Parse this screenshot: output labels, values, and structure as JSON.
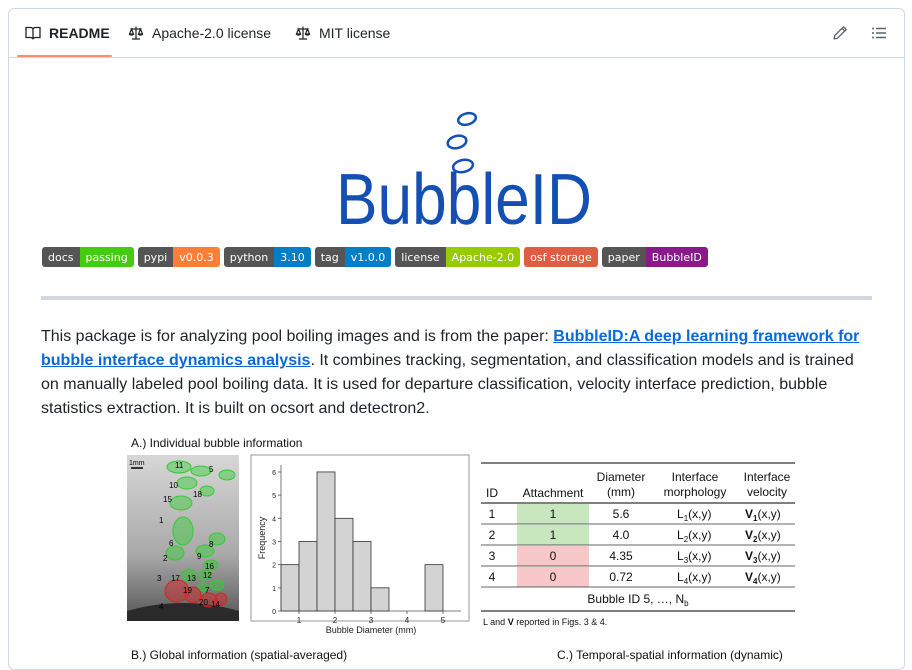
{
  "tabs": [
    {
      "label": "README",
      "icon": "book-icon",
      "active": true
    },
    {
      "label": "Apache-2.0 license",
      "icon": "scale-icon"
    },
    {
      "label": "MIT license",
      "icon": "scale-icon"
    }
  ],
  "logo_text": "BubbleID",
  "colors": {
    "accent": "#0969da",
    "tab_underline": "#fd8c73",
    "logo_blue": "#1450b4"
  },
  "badges": [
    {
      "label": "docs",
      "value": "passing",
      "color": "#4c1"
    },
    {
      "label": "pypi",
      "value": "v0.0.3",
      "color": "#fe7d37"
    },
    {
      "label": "python",
      "value": "3.10",
      "color": "#007ec6"
    },
    {
      "label": "tag",
      "value": "v1.0.0",
      "color": "#007ec6"
    },
    {
      "label": "license",
      "value": "Apache-2.0",
      "color": "#97ca00"
    },
    {
      "label": "osf storage",
      "value": "",
      "color": "#e05d44"
    },
    {
      "label": "paper",
      "value": "BubbleID",
      "color": "#8a1a8a"
    }
  ],
  "description": {
    "intro": "This package is for analyzing pool boiling images and is from the paper: ",
    "link_text": "BubbleID:A deep learning framework for bubble interface dynamics analysis",
    "rest": ". It combines tracking, segmentation, and classification models and is trained on manually labeled pool boiling data. It is used for departure classification, velocity interface prediction, bubble statistics extraction. It is built on ocsort and detectron2."
  },
  "figure": {
    "section_a_title": "A.) Individual bubble information",
    "section_b_title": "B.) Global information (spatial-averaged)",
    "section_c_title": "C.) Temporal-spatial information (dynamic)",
    "scale_label": "1mm",
    "bubble_labels": [
      "11",
      "5",
      "10",
      "18",
      "15",
      "1",
      "6",
      "2",
      "9",
      "8",
      "16",
      "12",
      "3",
      "17",
      "13",
      "7",
      "19",
      "20",
      "4",
      "14"
    ],
    "table": {
      "headers": [
        [
          "ID"
        ],
        [
          "Attachment"
        ],
        [
          "Diameter",
          "(mm)"
        ],
        [
          "Interface",
          "morphology"
        ],
        [
          "Interface",
          "velocity"
        ]
      ],
      "rows": [
        {
          "id": "1",
          "attachment": "1",
          "diameter": "5.6",
          "morph": "L",
          "sub": "1",
          "tail": "(x,y)",
          "vel": "V",
          "vsub": "1"
        },
        {
          "id": "2",
          "attachment": "1",
          "diameter": "4.0",
          "morph": "L",
          "sub": "2",
          "tail": "(x,y)",
          "vel": "V",
          "vsub": "2"
        },
        {
          "id": "3",
          "attachment": "0",
          "diameter": "4.35",
          "morph": "L",
          "sub": "3",
          "tail": "(x,y)",
          "vel": "V",
          "vsub": "3"
        },
        {
          "id": "4",
          "attachment": "0",
          "diameter": "0.72",
          "morph": "L",
          "sub": "4",
          "tail": "(x,y)",
          "vel": "V",
          "vsub": "4"
        }
      ],
      "footer_prefix": "Bubble ID 5, …, N",
      "footer_sub": "b",
      "note_bold": "L",
      "note_and": " and ",
      "note_bold2": "V",
      "note_tail": " reported in Figs. 3 & 4."
    }
  },
  "chart_data": {
    "type": "bar",
    "x": [
      0.75,
      1.25,
      1.75,
      2.25,
      2.75,
      3.25,
      3.75,
      4.25,
      4.75
    ],
    "values": [
      2,
      3,
      6,
      4,
      3,
      1,
      2
    ],
    "bin_centers": [
      0.75,
      1.25,
      1.75,
      2.25,
      2.75,
      3.25,
      4.75
    ],
    "bin_width": 0.5,
    "xlabel": "Bubble Diameter (mm)",
    "ylabel": "Frequency",
    "xticks": [
      "1",
      "2",
      "3",
      "4",
      "5"
    ],
    "yticks": [
      "0",
      "1",
      "2",
      "3",
      "4",
      "5",
      "6"
    ],
    "xlim": [
      0.5,
      5.5
    ],
    "ylim": [
      0,
      6.3
    ]
  }
}
